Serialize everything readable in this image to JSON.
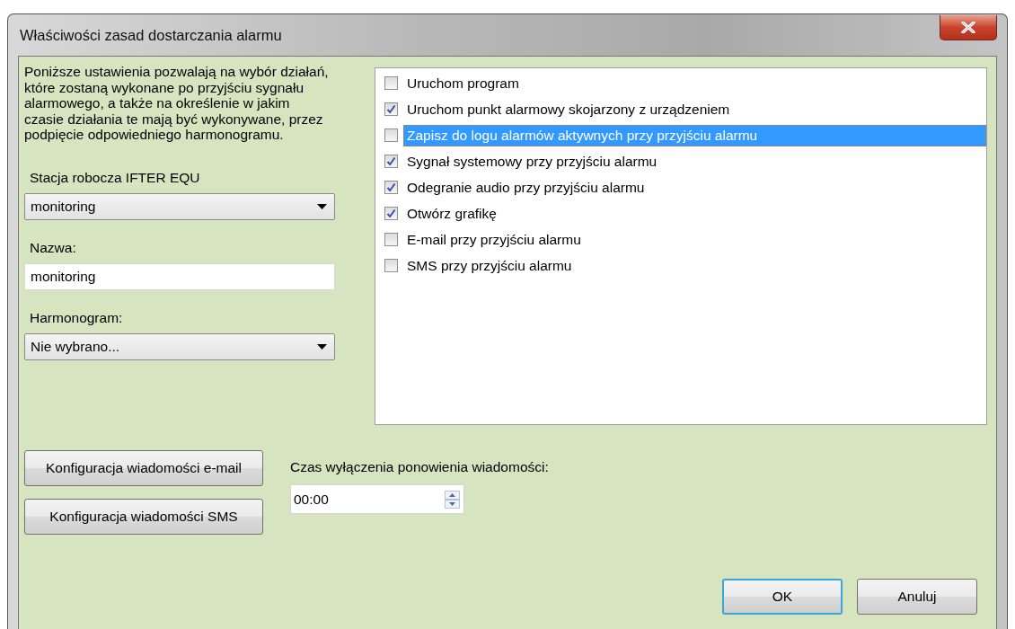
{
  "window": {
    "title": "Właściwości zasad dostarczania alarmu"
  },
  "description": "Poniższe ustawienia pozwalają na wybór działań, które zostaną wykonane po przyjściu sygnału alarmowego, a także na określenie w jakim czasie działania te mają być wykonywane, przez podpięcie odpowiedniego harmonogramu.",
  "fields": [
    {
      "kind": "combo",
      "label": "Stacja robocza IFTER EQU",
      "value": "monitoring"
    },
    {
      "kind": "text",
      "label": "Nazwa:",
      "value": "monitoring"
    },
    {
      "kind": "combo",
      "label": "Harmonogram:",
      "value": "Nie wybrano..."
    }
  ],
  "actions": [
    {
      "label": "Uruchom program",
      "checked": false,
      "selected": false
    },
    {
      "label": "Uruchom punkt alarmowy skojarzony z urządzeniem",
      "checked": true,
      "selected": false
    },
    {
      "label": "Zapisz do logu alarmów aktywnych przy przyjściu alarmu",
      "checked": false,
      "selected": true
    },
    {
      "label": "Sygnał systemowy przy przyjściu alarmu",
      "checked": true,
      "selected": false
    },
    {
      "label": "Odegranie audio przy przyjściu alarmu",
      "checked": true,
      "selected": false
    },
    {
      "label": "Otwórz grafikę",
      "checked": true,
      "selected": false
    },
    {
      "label": "E-mail przy przyjściu alarmu",
      "checked": false,
      "selected": false
    },
    {
      "label": "SMS przy przyjściu alarmu",
      "checked": false,
      "selected": false
    }
  ],
  "config_buttons": [
    "Konfiguracja wiadomości e-mail",
    "Konfiguracja wiadomości SMS"
  ],
  "timeout": {
    "label": "Czas wyłączenia ponowienia wiadomości:",
    "value": "00:00"
  },
  "buttons": [
    {
      "label": "OK",
      "default": true
    },
    {
      "label": "Anuluj",
      "default": false
    }
  ]
}
